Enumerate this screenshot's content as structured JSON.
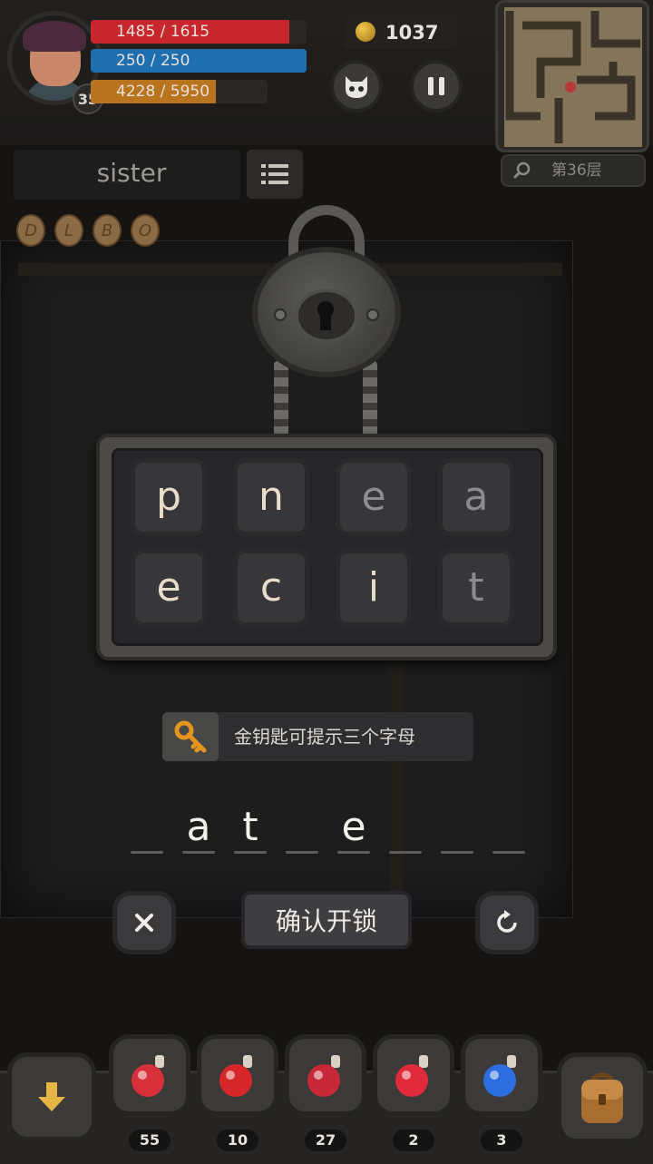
{
  "header": {
    "level": "35",
    "hp": "1485 / 1615",
    "hp_fraction": 0.92,
    "mp": "250 / 250",
    "mp_fraction": 1.0,
    "xp": "4228 / 5950",
    "xp_fraction": 0.71,
    "coins": "1037",
    "floor": "第36层"
  },
  "word_panel": {
    "word": "sister",
    "runes": [
      "D",
      "L",
      "B",
      "O"
    ]
  },
  "board": {
    "tiles": [
      {
        "letter": "p",
        "state": "on"
      },
      {
        "letter": "n",
        "state": "on"
      },
      {
        "letter": "e",
        "state": "off"
      },
      {
        "letter": "a",
        "state": "off"
      },
      {
        "letter": "e",
        "state": "on"
      },
      {
        "letter": "c",
        "state": "on"
      },
      {
        "letter": "i",
        "state": "on"
      },
      {
        "letter": "t",
        "state": "off"
      }
    ]
  },
  "hint": {
    "text": "金钥匙可提示三个字母"
  },
  "answer": {
    "slots": [
      "",
      "a",
      "t",
      "",
      "e",
      "",
      "",
      ""
    ]
  },
  "actions": {
    "confirm_label": "确认开锁"
  },
  "inventory": {
    "items": [
      {
        "icon": "potion-red-flask-icon",
        "count": "55",
        "color": "#d8303a"
      },
      {
        "icon": "apple-icon",
        "count": "10",
        "color": "#d6262a"
      },
      {
        "icon": "potion-red-jar-icon",
        "count": "27",
        "color": "#c72838"
      },
      {
        "icon": "potion-red-round-icon",
        "count": "2",
        "color": "#e02a3b"
      },
      {
        "icon": "potion-blue-round-icon",
        "count": "3",
        "color": "#2c6de0"
      }
    ]
  },
  "colors": {
    "hp": "#c7262c",
    "mp": "#1f6fb0",
    "xp": "#b8741f"
  }
}
